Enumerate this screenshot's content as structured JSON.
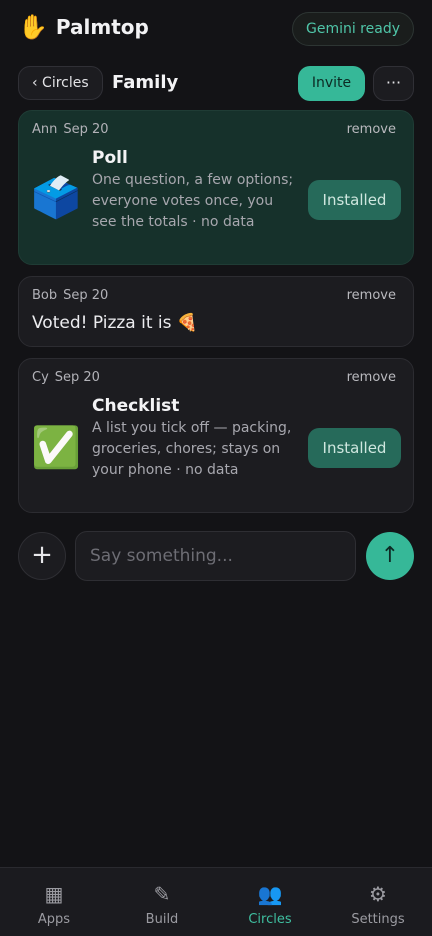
{
  "app": {
    "brand_icon": "✋",
    "brand_name": "Palmtop",
    "status": "Gemini ready"
  },
  "circle": {
    "back_label": "‹ Circles",
    "title": "Family",
    "invite_label": "Invite",
    "more_label": "···"
  },
  "messages": [
    {
      "sender": "Ann",
      "date": "Sep 20",
      "remove_label": "remove",
      "app_icon": "🗳️",
      "app_name": "Poll",
      "app_description": "One question, a few options; everyone votes once, you see the totals · no data",
      "app_status": "Installed"
    },
    {
      "sender": "Bob",
      "date": "Sep 20",
      "remove_label": "remove",
      "text": "Voted! Pizza it is 🍕"
    },
    {
      "sender": "Cy",
      "date": "Sep 20",
      "remove_label": "remove",
      "app_icon": "✅",
      "app_name": "Checklist",
      "app_description": "A list you tick off — packing, groceries, chores; stays on your phone · no data",
      "app_status": "Installed"
    }
  ],
  "composer": {
    "plus_icon": "+",
    "placeholder": "Say something...",
    "send_icon": "↑"
  },
  "nav": [
    {
      "icon": "▦",
      "label": "Apps",
      "active": false
    },
    {
      "icon": "✎",
      "label": "Build",
      "active": false
    },
    {
      "icon": "👥",
      "label": "Circles",
      "active": true
    },
    {
      "icon": "⚙",
      "label": "Settings",
      "active": false
    }
  ],
  "colors": {
    "accent": "#36b898",
    "background": "#131316",
    "card": "#1c1c20",
    "highlight_card": "#16312b"
  }
}
